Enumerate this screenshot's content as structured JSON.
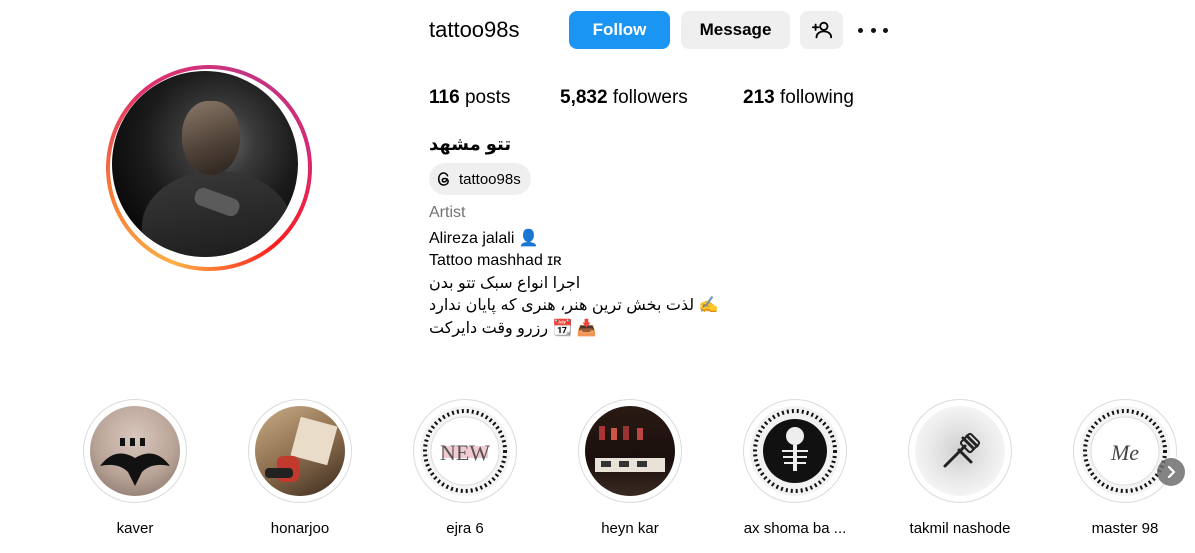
{
  "profile": {
    "username": "tattoo98s",
    "follow_label": "Follow",
    "message_label": "Message",
    "posts_count": "116",
    "posts_label": "posts",
    "followers_count": "5,832",
    "followers_label": "followers",
    "following_count": "213",
    "following_label": "following",
    "full_name": "تتو مشهد",
    "threads_handle": "tattoo98s",
    "category": "Artist",
    "bio": [
      "Alireza jalali 👤",
      "Tattoo mashhad ɪʀ",
      "اجرا انواع سبک تتو بدن",
      "✍️ لذت بخش ترین هنر، هنری که پایان ندارد",
      "📥 📆 رزرو وقت دایرکت"
    ]
  },
  "highlights": [
    {
      "label": "kaver"
    },
    {
      "label": "honarjoo"
    },
    {
      "label": "ejra 6",
      "text": "NEW"
    },
    {
      "label": "heyn kar"
    },
    {
      "label": "ax shoma ba ..."
    },
    {
      "label": "takmil nashode"
    },
    {
      "label": "master 98",
      "text": "Me"
    }
  ],
  "colors": {
    "follow_blue": "#1a95f3",
    "button_gray": "#efefef",
    "muted_text": "#737373"
  },
  "icons": [
    "add-person-icon",
    "more-dots-icon",
    "threads-icon",
    "chevron-right-icon"
  ]
}
